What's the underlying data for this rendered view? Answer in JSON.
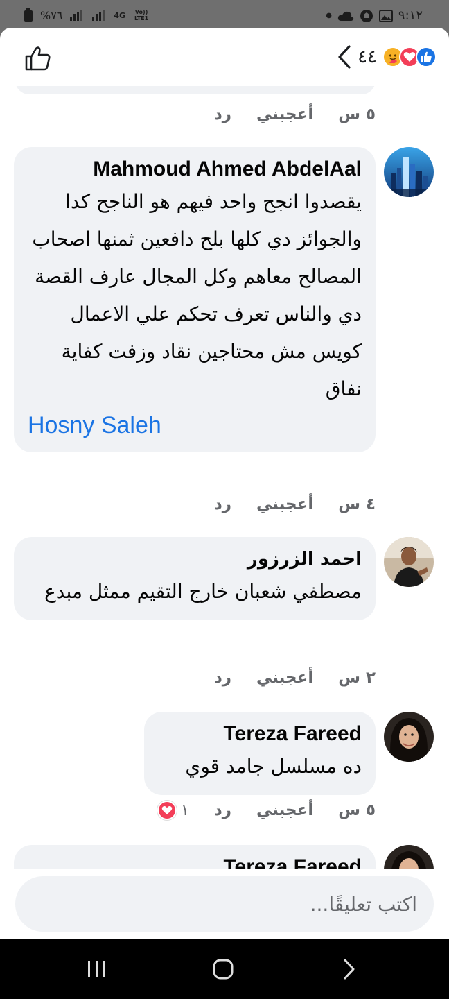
{
  "status_bar": {
    "battery": "%٧٦",
    "network": "4G",
    "volte": "Vo)) LTE1",
    "time": "٩:١٢"
  },
  "header": {
    "reaction_count": "٤٤",
    "icons": [
      "care-reaction-icon",
      "love-reaction-icon",
      "like-reaction-icon"
    ]
  },
  "actions": {
    "like": "أعجبني",
    "reply": "رد"
  },
  "prev_meta": {
    "time": "٥ س"
  },
  "comments": [
    {
      "author": "Mahmoud Ahmed AbdelAal",
      "text": "يقصدوا انجح واحد فيهم هو الناجح كدا\nوالجوائز دي كلها بلح دافعين ثمنها اصحاب المصالح معاهم وكل المجال عارف القصة دي والناس تعرف تحكم علي الاعمال كويس مش محتاجين نقاد وزفت كفاية نفاق",
      "mention": "Hosny Saleh",
      "time": "٤ س"
    },
    {
      "author": "احمد الزرزور",
      "text": "مصطفي شعبان خارج التقيم ممثل مبدع",
      "time": "٢ س"
    },
    {
      "author": "Tereza Fareed",
      "text": "ده مسلسل جامد قوي",
      "time": "٥ س",
      "reaction_count": "١"
    },
    {
      "author": "Tereza Fareed"
    }
  ],
  "composer": {
    "placeholder": "اكتب تعليقًا..."
  },
  "colors": {
    "accent": "#1b74e4",
    "bubble": "#f0f2f5",
    "meta": "#65676b"
  }
}
